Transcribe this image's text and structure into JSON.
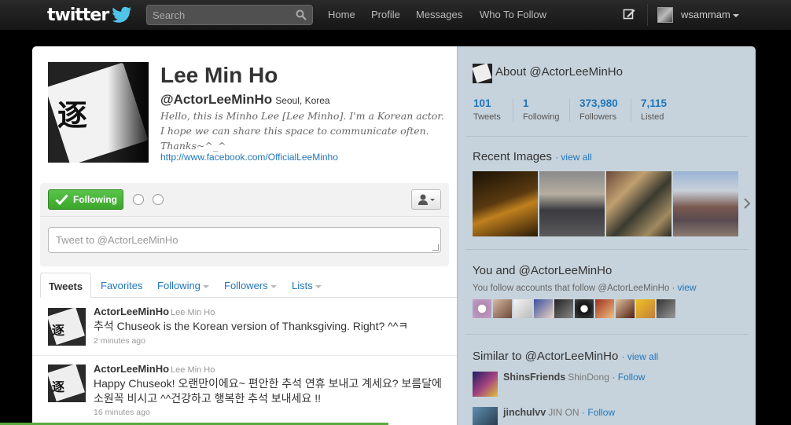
{
  "topbar": {
    "logo": "twitter",
    "search_placeholder": "Search",
    "nav": [
      "Home",
      "Profile",
      "Messages",
      "Who To Follow"
    ],
    "username": "wsammam"
  },
  "profile": {
    "name": "Lee Min Ho",
    "handle": "@ActorLeeMinHo",
    "location": "Seoul, Korea",
    "bio": "Hello, this is Minho Lee [Lee Minho]. I'm a Korean actor. I hope we can share this space to communicate often. Thanks~^_^",
    "url": "http://www.facebook.com/OfficialLeeMinho",
    "avatar_glyph": "逐"
  },
  "actions": {
    "following_label": "Following",
    "tweet_placeholder": "Tweet to @ActorLeeMinHo"
  },
  "tabs": [
    {
      "label": "Tweets"
    },
    {
      "label": "Favorites"
    },
    {
      "label": "Following"
    },
    {
      "label": "Followers"
    },
    {
      "label": "Lists"
    }
  ],
  "tweets": [
    {
      "user": "ActorLeeMinHo",
      "fullname": "Lee Min Ho",
      "text": "추석 Chuseok is the Korean version of Thanksgiving. Right? ^^ㅋ",
      "time": "2 minutes ago"
    },
    {
      "user": "ActorLeeMinHo",
      "fullname": "Lee Min Ho",
      "text": "Happy Chuseok! 오랜만이에요~ 편안한 추석 연휴 보내고 계세요? 보름달에 소원꼭 비시고 ^^건강하고 행복한 추석 보내세요 !!",
      "time": "16 minutes ago"
    }
  ],
  "sidebar": {
    "about_title": "About @ActorLeeMinHo",
    "stats": [
      {
        "num": "101",
        "label": "Tweets"
      },
      {
        "num": "1",
        "label": "Following"
      },
      {
        "num": "373,980",
        "label": "Followers"
      },
      {
        "num": "7,115",
        "label": "Listed"
      }
    ],
    "recent_images_title": "Recent Images",
    "view_all": "view all",
    "you_and_title": "You and @ActorLeeMinHo",
    "you_follow_text": "You follow accounts that follow @ActorLeeMinHo ·",
    "view": "view",
    "similar_title": "Similar to @ActorLeeMinHo",
    "similar": [
      {
        "name": "ShinsFriends",
        "fullname": "ShinDong",
        "follow": "Follow"
      },
      {
        "name": "jinchulvv",
        "fullname": "JIN ON",
        "follow": "Follow"
      }
    ]
  },
  "colors": {
    "link": "#2276bb",
    "follow_green": "#3ca62c",
    "sidebar_bg": "#c6d3dc"
  }
}
